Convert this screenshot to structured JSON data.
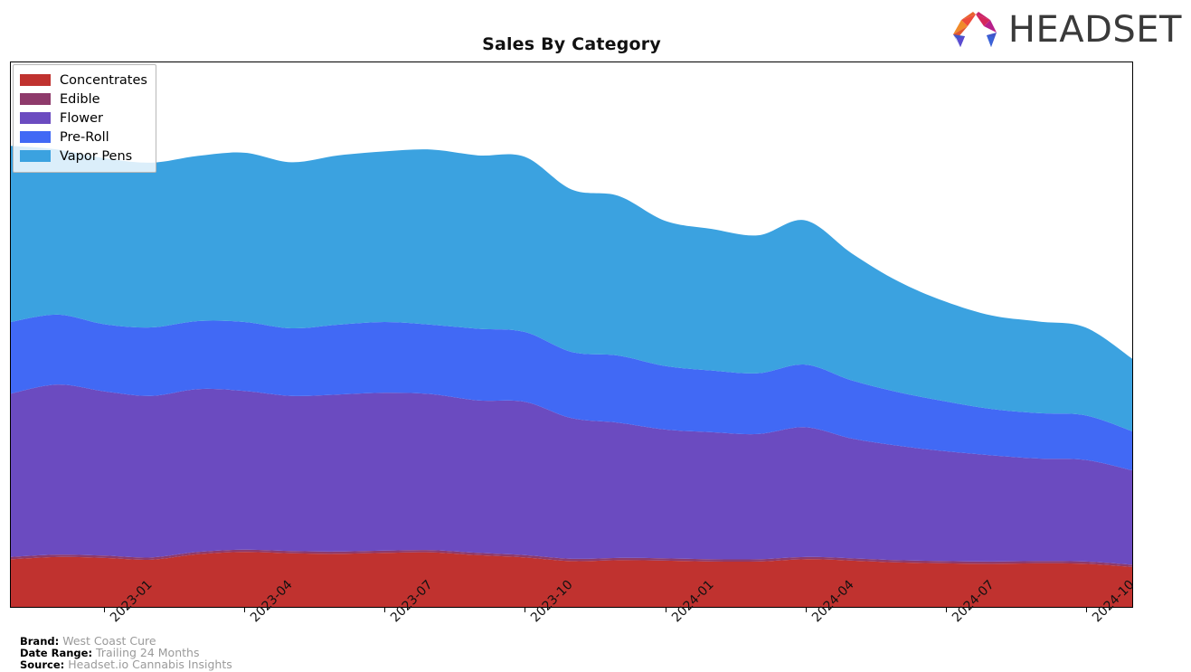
{
  "header": {
    "title": "Sales By Category",
    "logo_word": "HEADSET",
    "logo_icon": "headset-arch-logo"
  },
  "legend": {
    "position": "top-left",
    "items": [
      {
        "label": "Concentrates",
        "color": "#C0322F"
      },
      {
        "label": "Edible",
        "color": "#8E3A6B"
      },
      {
        "label": "Flower",
        "color": "#6B4BC0"
      },
      {
        "label": "Pre-Roll",
        "color": "#4169F5"
      },
      {
        "label": "Vapor Pens",
        "color": "#3BA2E0"
      }
    ]
  },
  "footer": {
    "rows": [
      {
        "key": "Brand:",
        "value": "West Coast Cure"
      },
      {
        "key": "Date Range:",
        "value": "Trailing 24 Months"
      },
      {
        "key": "Source:",
        "value": "Headset.io Cannabis Insights"
      }
    ]
  },
  "axis": {
    "x_ticks": [
      "2023-01",
      "2023-04",
      "2023-07",
      "2023-10",
      "2024-01",
      "2024-04",
      "2024-07",
      "2024-10"
    ],
    "y_ticks": []
  },
  "chart_data": {
    "type": "area",
    "stacked": true,
    "title": "Sales By Category",
    "xlabel": "",
    "ylabel": "",
    "grid": false,
    "legend_position": "upper left",
    "x": [
      "2022-11",
      "2022-12",
      "2023-01",
      "2023-02",
      "2023-03",
      "2023-04",
      "2023-05",
      "2023-06",
      "2023-07",
      "2023-08",
      "2023-09",
      "2023-10",
      "2023-11",
      "2023-12",
      "2024-01",
      "2024-02",
      "2024-03",
      "2024-04",
      "2024-05",
      "2024-06",
      "2024-07",
      "2024-08",
      "2024-09",
      "2024-10",
      "2024-11"
    ],
    "series": [
      {
        "name": "Concentrates",
        "color": "#C0322F",
        "values": [
          10.5,
          11.0,
          10.8,
          10.4,
          11.6,
          12.1,
          11.8,
          11.7,
          11.9,
          12.0,
          11.4,
          10.9,
          10.1,
          10.3,
          10.2,
          10.0,
          10.0,
          10.5,
          10.2,
          9.8,
          9.6,
          9.5,
          9.6,
          9.5,
          8.8
        ]
      },
      {
        "name": "Edible",
        "color": "#8E3A6B",
        "values": [
          0.5,
          0.5,
          0.5,
          0.5,
          0.5,
          0.5,
          0.5,
          0.5,
          0.5,
          0.5,
          0.5,
          0.5,
          0.5,
          0.5,
          0.5,
          0.5,
          0.5,
          0.5,
          0.5,
          0.5,
          0.5,
          0.5,
          0.5,
          0.5,
          0.5
        ]
      },
      {
        "name": "Flower",
        "color": "#6B4BC0",
        "values": [
          36.0,
          37.5,
          36.2,
          35.6,
          35.9,
          35.0,
          34.2,
          34.6,
          34.8,
          34.4,
          33.6,
          33.8,
          31.0,
          29.8,
          28.4,
          28.0,
          27.6,
          28.6,
          26.4,
          25.2,
          24.2,
          23.4,
          22.6,
          22.4,
          20.8
        ]
      },
      {
        "name": "Pre-Roll",
        "color": "#4169F5",
        "values": [
          15.8,
          15.4,
          14.8,
          15.1,
          15.0,
          15.2,
          14.9,
          15.4,
          15.6,
          15.3,
          15.8,
          15.4,
          14.6,
          14.8,
          14.0,
          13.6,
          13.4,
          13.8,
          12.8,
          11.8,
          11.0,
          10.2,
          10.0,
          9.8,
          8.6
        ]
      },
      {
        "name": "Vapor Pens",
        "color": "#3BA2E0",
        "values": [
          38.8,
          36.4,
          36.6,
          36.3,
          36.4,
          37.3,
          36.6,
          37.3,
          37.6,
          38.6,
          38.2,
          38.6,
          35.8,
          35.2,
          32.0,
          31.2,
          30.4,
          31.8,
          28.0,
          24.4,
          22.0,
          20.6,
          20.2,
          19.4,
          16.0
        ]
      }
    ],
    "ylim": [
      0,
      120
    ],
    "total_peak": "2023-10",
    "trend": "declining"
  }
}
